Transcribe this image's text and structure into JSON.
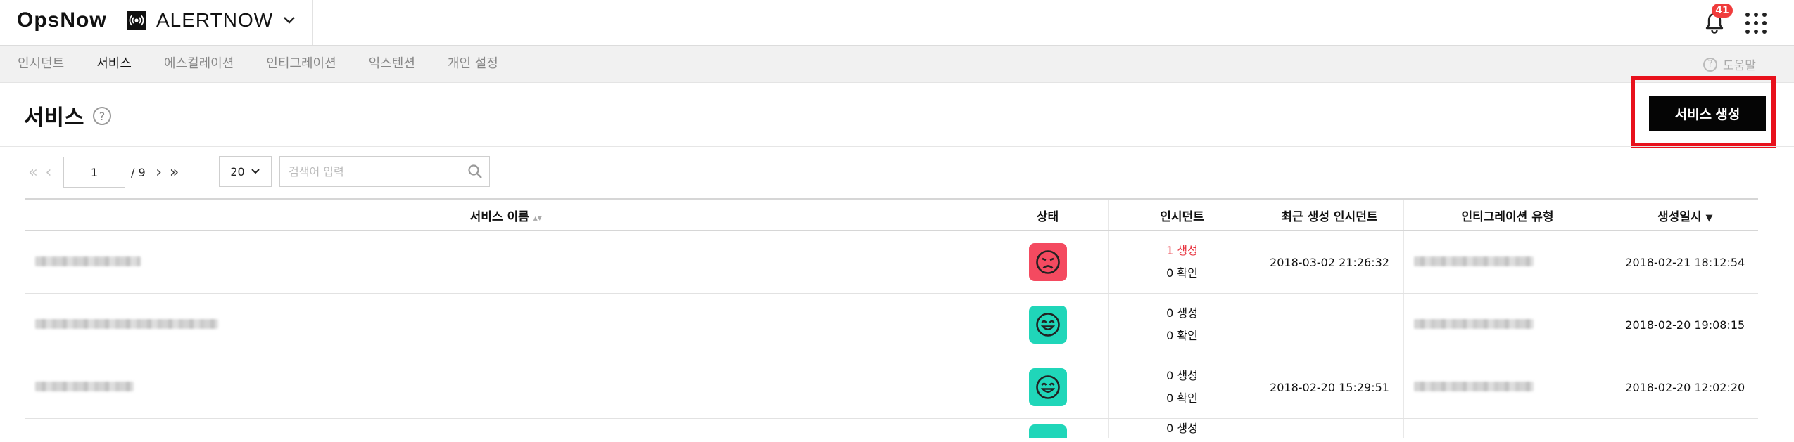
{
  "app": {
    "logo": "OpsNow",
    "product": "ALERTNOW",
    "notifications_count": "41"
  },
  "nav": {
    "items": [
      "인시던트",
      "서비스",
      "에스컬레이션",
      "인티그레이션",
      "익스텐션",
      "개인 설정"
    ],
    "active": "서비스",
    "help": "도움말"
  },
  "page": {
    "title": "서비스",
    "create_button": "서비스 생성",
    "colors": {
      "highlight": "#e8111c",
      "sad": "#f44a60",
      "happy": "#20d6b9",
      "incident_active": "#e8323e"
    }
  },
  "pagination": {
    "current_page": "1",
    "total": "/ 9",
    "page_size": "20"
  },
  "search": {
    "placeholder": "검색어 입력"
  },
  "table": {
    "columns": [
      "서비스 이름",
      "상태",
      "인시던트",
      "최근 생성 인시던트",
      "인티그레이션 유형",
      "생성일시"
    ],
    "rows": [
      {
        "status": "sad-face-icon",
        "incident_created": "1 생성",
        "incident_ack": "0 확인",
        "latest_incident": "2018-03-02 21:26:32",
        "created_at": "2018-02-21 18:12:54"
      },
      {
        "status": "happy-face-icon",
        "incident_created": "0 생성",
        "incident_ack": "0 확인",
        "latest_incident": "",
        "created_at": "2018-02-20 19:08:15"
      },
      {
        "status": "happy-face-icon",
        "incident_created": "0 생성",
        "incident_ack": "0 확인",
        "latest_incident": "2018-02-20 15:29:51",
        "created_at": "2018-02-20 12:02:20"
      },
      {
        "status": "happy-face-icon",
        "incident_created": "0 생성",
        "incident_ack": "",
        "latest_incident": "",
        "created_at": ""
      }
    ]
  }
}
